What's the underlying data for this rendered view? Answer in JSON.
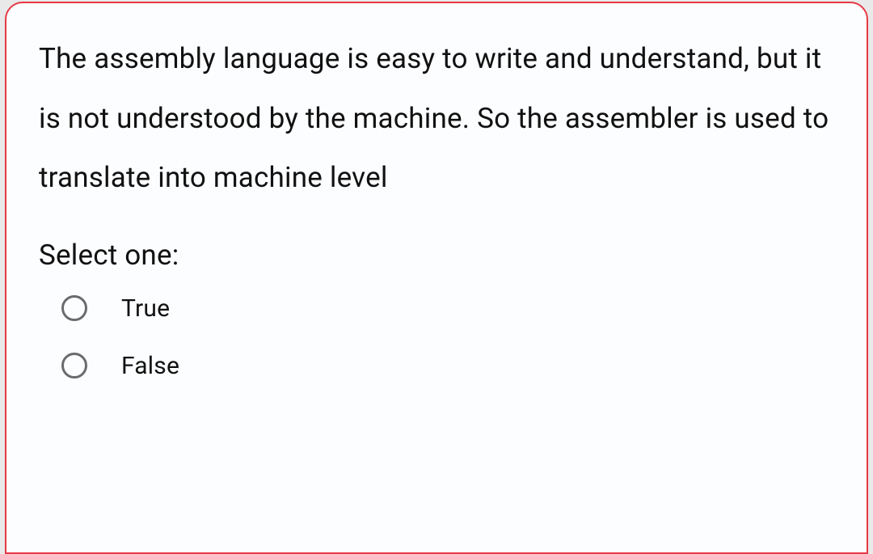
{
  "question": {
    "text": "The assembly language is easy to write and understand, but it is not understood by the machine. So the assembler is used to translate into machine level",
    "prompt": "Select one:",
    "options": [
      {
        "label": "True",
        "selected": false
      },
      {
        "label": "False",
        "selected": false
      }
    ]
  },
  "style": {
    "border_color": "#e63946",
    "background": "#fcfdff"
  }
}
